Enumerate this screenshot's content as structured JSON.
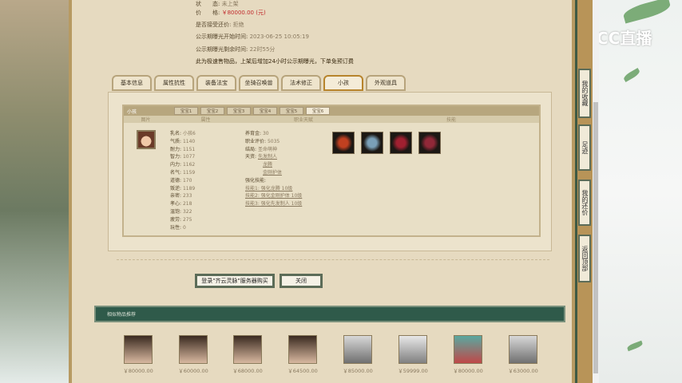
{
  "item": {
    "status_label": "状　　态:",
    "status_value": "未上架",
    "price_label": "价　　格:",
    "price_value": "￥80000.00 (元)",
    "counter_label": "是否接受还价:",
    "counter_value": "拒绝",
    "start_label": "公示期曝光开始时间:",
    "start_value": "2023-06-25 10:05:19",
    "remain_label": "公示期曝光剩余时间:",
    "remain_value": "22时55分",
    "notice": "此为极速售物品，上架后增加24小时公示期曝光，下单免预订费"
  },
  "tabs": [
    "基本信息",
    "属性抗性",
    "装备法宝",
    "坐骑召唤兽",
    "法术修正",
    "小孩",
    "外观道具"
  ],
  "active_tab": "小孩",
  "kid": {
    "title": "小孩",
    "subtabs": [
      "宝宝1",
      "宝宝2",
      "宝宝3",
      "宝宝4",
      "宝宝5",
      "宝宝6"
    ],
    "columns": [
      "图片",
      "属性",
      "职业天赋",
      "技能"
    ],
    "attrs": [
      {
        "k": "乳名:",
        "v": "小孩6"
      },
      {
        "k": "气质:",
        "v": "1140"
      },
      {
        "k": "耐力:",
        "v": "1151"
      },
      {
        "k": "智力:",
        "v": "1077"
      },
      {
        "k": "内力:",
        "v": "1162"
      },
      {
        "k": "名气:",
        "v": "1159"
      },
      {
        "k": "道德:",
        "v": "170"
      },
      {
        "k": "叛逆:",
        "v": "1189"
      },
      {
        "k": "亲密:",
        "v": "233"
      },
      {
        "k": "孝心:",
        "v": "218"
      },
      {
        "k": "温饱:",
        "v": "322"
      },
      {
        "k": "疲劳:",
        "v": "275"
      },
      {
        "k": "玩性:",
        "v": "0"
      }
    ],
    "money_label": "养育金:",
    "money": "30",
    "eval_label": "职业评价:",
    "eval": "5035",
    "ending_label": "结局:",
    "ending": "圣命萌神",
    "talent_label": "天资:",
    "talents": [
      "先发制人",
      "龙腾",
      "金刚护体"
    ],
    "enhance_label": "强化技能:",
    "skills": [
      "技能1: 强化龙腾 10级",
      "技能2: 强化金刚护体 10级",
      "技能3: 强化先发制人 10级"
    ]
  },
  "buttons": {
    "login": "登录\"齐云灵脉\"服务器购买",
    "close": "关闭"
  },
  "recommend": {
    "title": "相似物品推荐",
    "prices": [
      "￥80000.00",
      "￥60000.00",
      "￥68000.00",
      "￥64500.00",
      "￥85000.00",
      "￥59999.00",
      "￥80000.00",
      "￥63000.00"
    ]
  },
  "side": [
    "我的收藏",
    "足迹",
    "我的还价",
    "返回顶部"
  ],
  "logo": "CC直播"
}
